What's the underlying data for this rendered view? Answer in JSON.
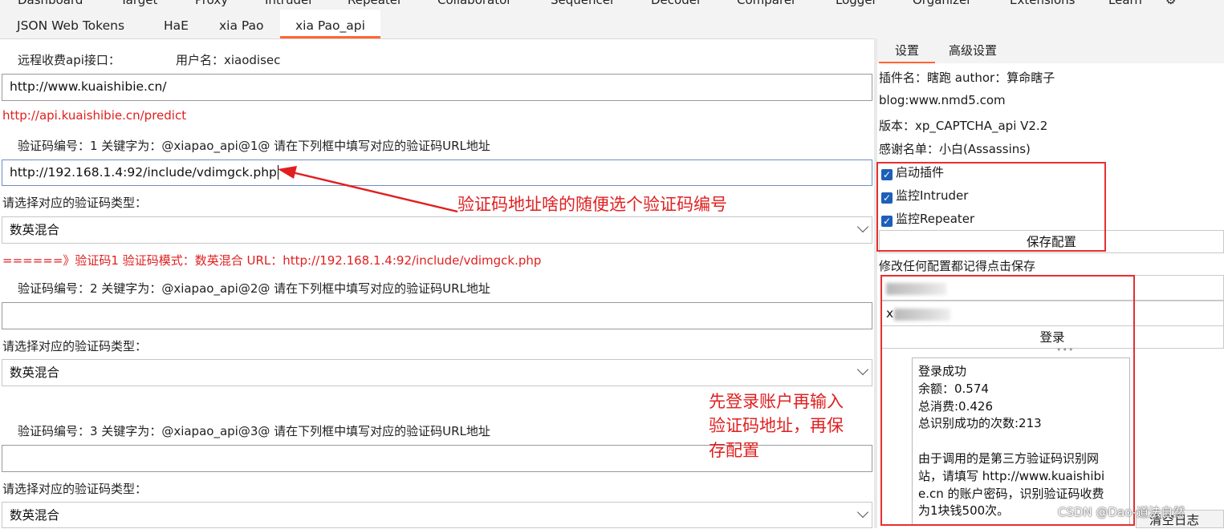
{
  "top_menu": [
    "Dashboard",
    "Target",
    "Proxy",
    "Intruder",
    "Repeater",
    "Collaborator",
    "Sequencer",
    "Decoder",
    "Comparer",
    "Logger",
    "Organizer",
    "Extensions",
    "Learn"
  ],
  "tabs": [
    "JSON Web Tokens",
    "HaE",
    "xia Pao",
    "xia Pao_api"
  ],
  "left": {
    "remote_api_label": "远程收费api接口：",
    "username_label": "用户名：xiaodisec",
    "site_url": "http://www.kuaishibie.cn/",
    "predict_url": "http://api.kuaishibie.cn/predict",
    "captcha_select_label": "请选择对应的验证码类型：",
    "blocks": [
      {
        "header": "验证码编号：1  关键字为：@xiapao_api@1@    请在下列框中填写对应的验证码URL地址",
        "url": "http://192.168.1.4:92/include/vdimgck.php",
        "type": "数英混合"
      },
      {
        "header": "验证码编号：2  关键字为：@xiapao_api@2@    请在下列框中填写对应的验证码URL地址",
        "url": "",
        "type": "数英混合"
      },
      {
        "header": "验证码编号：3  关键字为：@xiapao_api@3@    请在下列框中填写对应的验证码URL地址",
        "url": "",
        "type": "数英混合"
      }
    ],
    "status_line": "======》验证码1    验证码模式：数英混合    URL：http://192.168.1.4:92/include/vdimgck.php"
  },
  "right": {
    "tabs": [
      "设置",
      "高级设置"
    ],
    "plugin_name": "插件名：瞎跑 author：算命瞎子",
    "blog": "blog:www.nmd5.com",
    "version": "版本：xp_CAPTCHA_api V2.2",
    "thanks": "感谢名单：小白(Assassins)",
    "checkboxes": [
      "启动插件",
      "监控Intruder",
      "监控Repeater"
    ],
    "save_button": "保存配置",
    "save_hint": "修改任何配置都记得点击保存",
    "login_password_prefix": "x",
    "login_button": "登录",
    "result_lines": [
      "登录成功",
      "余额：0.574",
      "总消费:0.426",
      "总识别成功的次数:213",
      "",
      "由于调用的是第三方验证码识别网",
      "站，请填写 http://www.kuaishibi",
      "e.cn 的账户密码，识别验证码收费",
      "为1块钱500次。"
    ],
    "clear_log_button": "清空日志"
  },
  "annotations": {
    "arrow_note": "验证码地址啥的随便选个验证码编号",
    "login_note_1": "先登录账户再输入",
    "login_note_2": "验证码地址，再保",
    "login_note_3": "存配置"
  },
  "watermark": "CSDN @Dao-道法自然",
  "colors": {
    "accent": "#ff6633",
    "annotation_red": "#e02020",
    "checkbox_blue": "#1d5fb8"
  }
}
